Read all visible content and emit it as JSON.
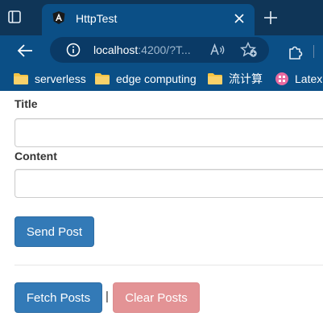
{
  "browser": {
    "tab": {
      "title": "HttpTest"
    },
    "address": {
      "host": "localhost",
      "rest": ":4200/?T..."
    },
    "bookmarks": [
      {
        "label": "serverless",
        "icon": "folder-icon"
      },
      {
        "label": "edge computing",
        "icon": "folder-icon"
      },
      {
        "label": "流计算",
        "icon": "folder-icon"
      },
      {
        "label": "Latex",
        "icon": "site-favicon"
      }
    ]
  },
  "form": {
    "title_label": "Title",
    "title_value": "",
    "content_label": "Content",
    "content_value": "",
    "send_button": "Send Post"
  },
  "actions": {
    "fetch_button": "Fetch Posts",
    "separator": "|",
    "clear_button": "Clear Posts"
  },
  "colors": {
    "chrome_dark": "#0f3557",
    "chrome": "#0b4f86",
    "primary": "#337ab7",
    "danger_light": "#e39395"
  }
}
